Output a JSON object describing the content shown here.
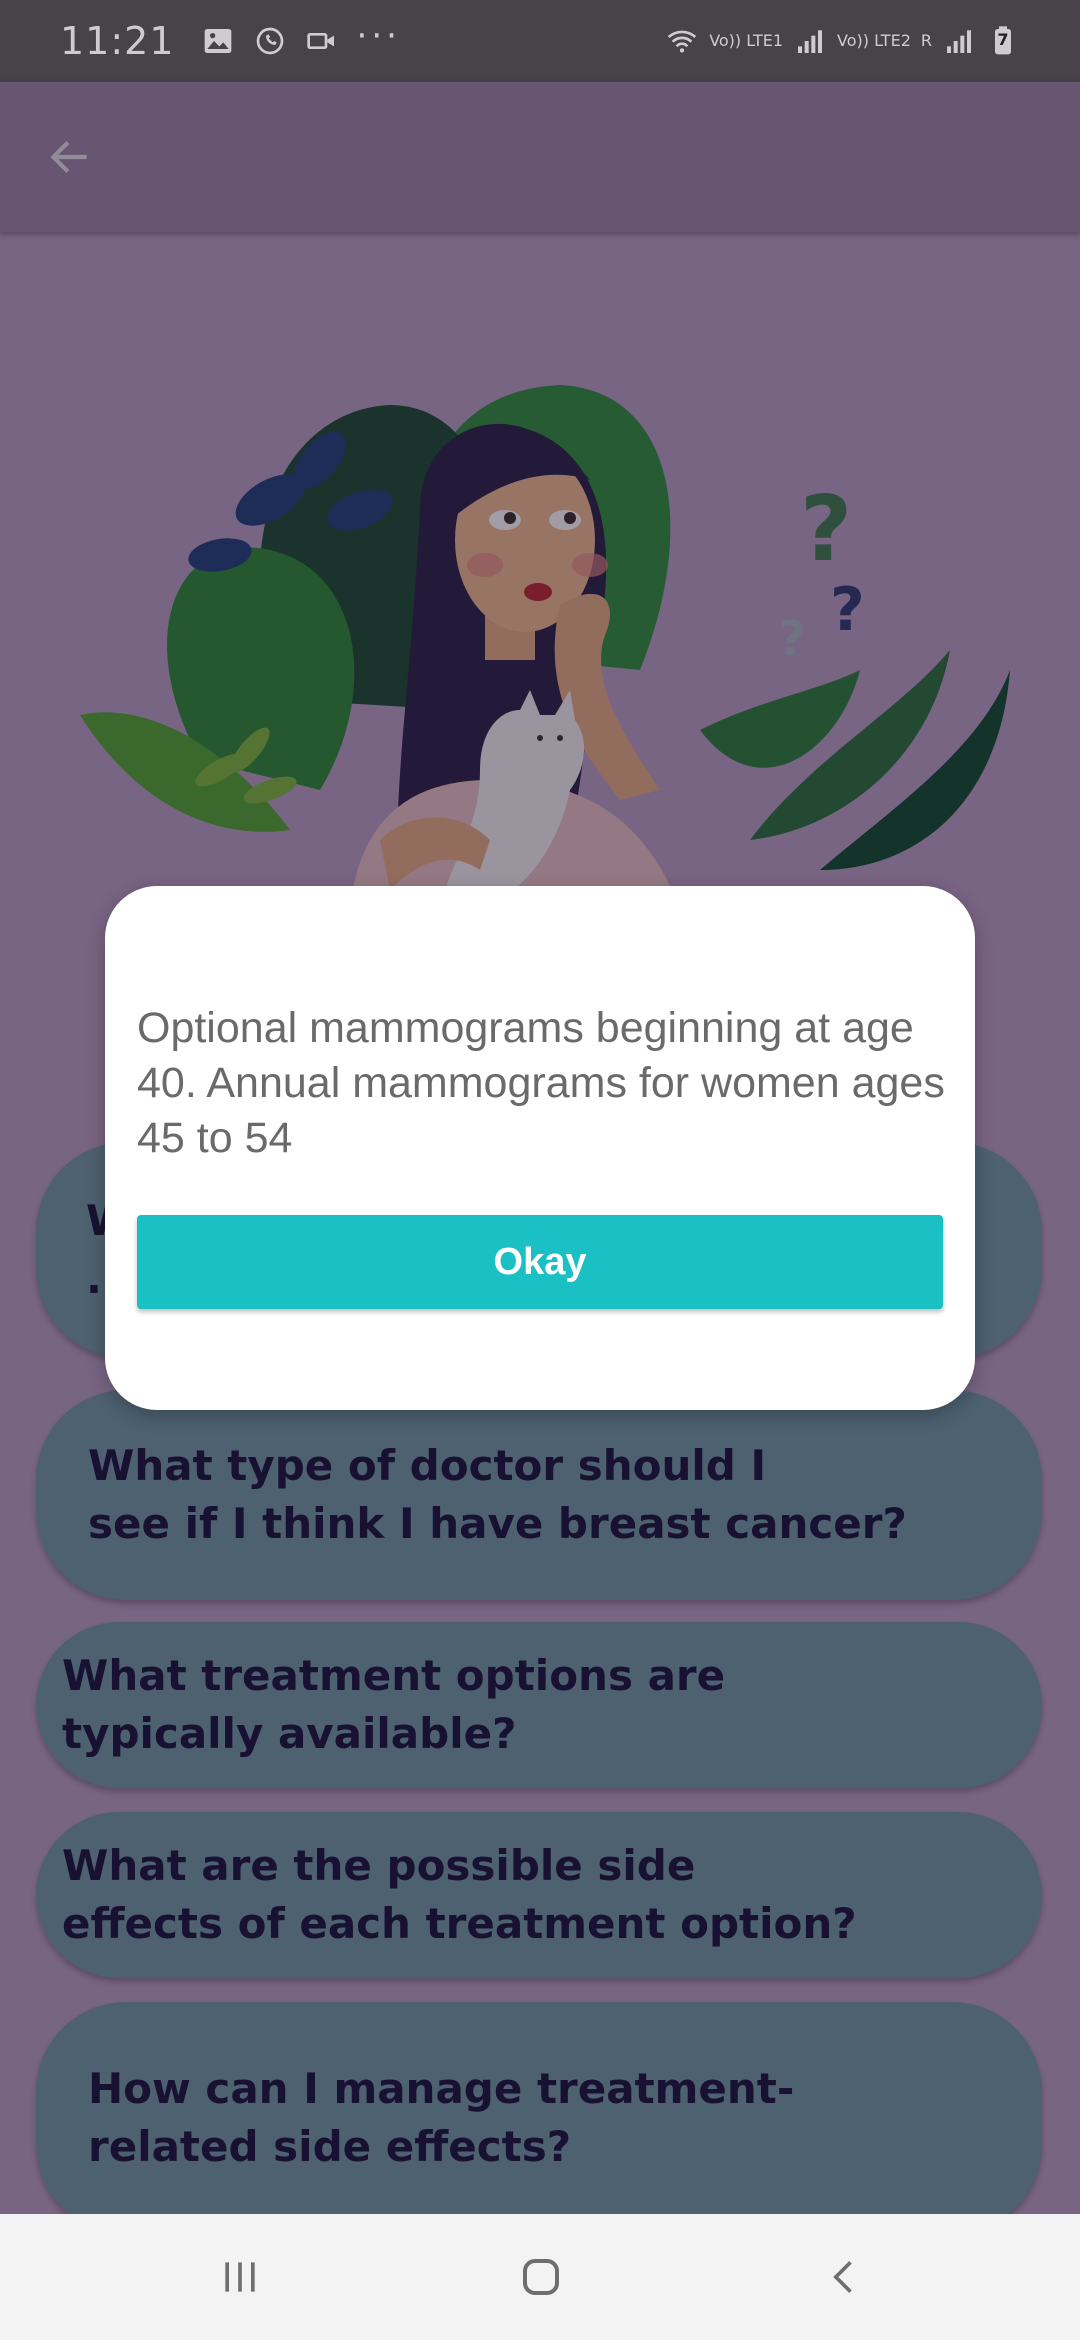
{
  "status_bar": {
    "time": "11:21",
    "left_icons": [
      "gallery-icon",
      "whatsapp-icon",
      "video-icon"
    ],
    "overflow": "···",
    "sim1_tag": "Vo)) LTE1",
    "sim2_tag": "Vo)) LTE2",
    "roaming": "R",
    "battery_level": "7"
  },
  "app_bar": {
    "back_icon": "arrow-left-icon"
  },
  "faq": [
    {
      "text": "W\n."
    },
    {
      "text": "What type of doctor should I\nsee if I think I have breast cancer?"
    },
    {
      "text": "What treatment options are\n typically available?"
    },
    {
      "text": "What are the possible side\n effects of each treatment option?"
    },
    {
      "text": "How can I manage treatment-\nrelated side effects?"
    }
  ],
  "dialog": {
    "message": "Optional mammograms beginning at age 40. Annual mammograms for women ages 45 to 54",
    "ok_label": "Okay",
    "ok_color": "#1bc0c5"
  },
  "nav_bar": {
    "recents_icon": "recents-icon",
    "home_icon": "home-icon",
    "back_icon": "back-icon"
  },
  "colors": {
    "app_bar": "#9b85a8",
    "card": "#6f9aa5",
    "card_text": "#16103a"
  }
}
